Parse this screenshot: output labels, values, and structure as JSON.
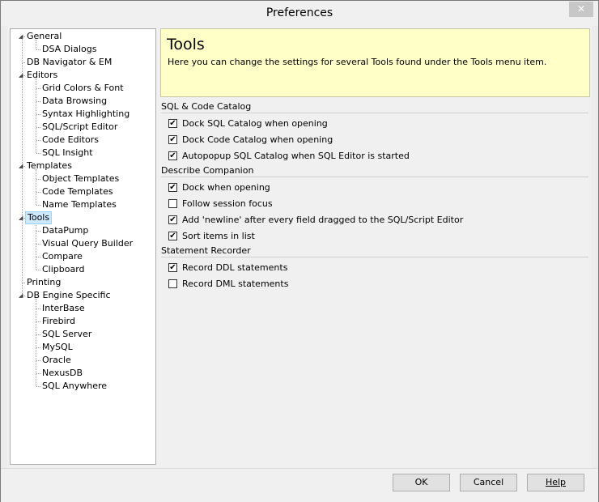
{
  "window": {
    "title": "Preferences",
    "close_glyph": "✕"
  },
  "tree": {
    "items": [
      {
        "label": "General",
        "expanded": true
      },
      {
        "label": "DSA Dialogs"
      },
      {
        "label": "DB Navigator & EM"
      },
      {
        "label": "Editors",
        "expanded": true
      },
      {
        "label": "Grid Colors & Font"
      },
      {
        "label": "Data Browsing"
      },
      {
        "label": "Syntax Highlighting"
      },
      {
        "label": "SQL/Script Editor"
      },
      {
        "label": "Code Editors"
      },
      {
        "label": "SQL Insight"
      },
      {
        "label": "Templates",
        "expanded": true
      },
      {
        "label": "Object Templates"
      },
      {
        "label": "Code Templates"
      },
      {
        "label": "Name Templates"
      },
      {
        "label": "Tools",
        "expanded": true,
        "selected": true
      },
      {
        "label": "DataPump"
      },
      {
        "label": "Visual Query Builder"
      },
      {
        "label": "Compare"
      },
      {
        "label": "Clipboard"
      },
      {
        "label": "Printing"
      },
      {
        "label": "DB Engine Specific",
        "expanded": true
      },
      {
        "label": "InterBase"
      },
      {
        "label": "Firebird"
      },
      {
        "label": "SQL Server"
      },
      {
        "label": "MySQL"
      },
      {
        "label": "Oracle"
      },
      {
        "label": "NexusDB"
      },
      {
        "label": "SQL Anywhere"
      }
    ]
  },
  "banner": {
    "title": "Tools",
    "description": "Here you can change the settings for several Tools found under the Tools menu item."
  },
  "groups": [
    {
      "title": "SQL & Code Catalog",
      "options": [
        {
          "label": "Dock SQL Catalog when opening",
          "checked": true
        },
        {
          "label": "Dock Code Catalog when opening",
          "checked": true
        },
        {
          "label": "Autopopup SQL Catalog when SQL Editor is started",
          "checked": true
        }
      ]
    },
    {
      "title": "Describe Companion",
      "options": [
        {
          "label": "Dock when opening",
          "checked": true
        },
        {
          "label": "Follow session focus",
          "checked": false
        },
        {
          "label": "Add 'newline' after every field dragged to the SQL/Script Editor",
          "checked": true
        },
        {
          "label": "Sort items in list",
          "checked": true
        }
      ]
    },
    {
      "title": "Statement Recorder",
      "options": [
        {
          "label": "Record DDL statements",
          "checked": true
        },
        {
          "label": "Record DML statements",
          "checked": false
        }
      ]
    }
  ],
  "buttons": {
    "ok": "OK",
    "cancel": "Cancel",
    "help": "Help"
  },
  "check_glyph": "✔"
}
